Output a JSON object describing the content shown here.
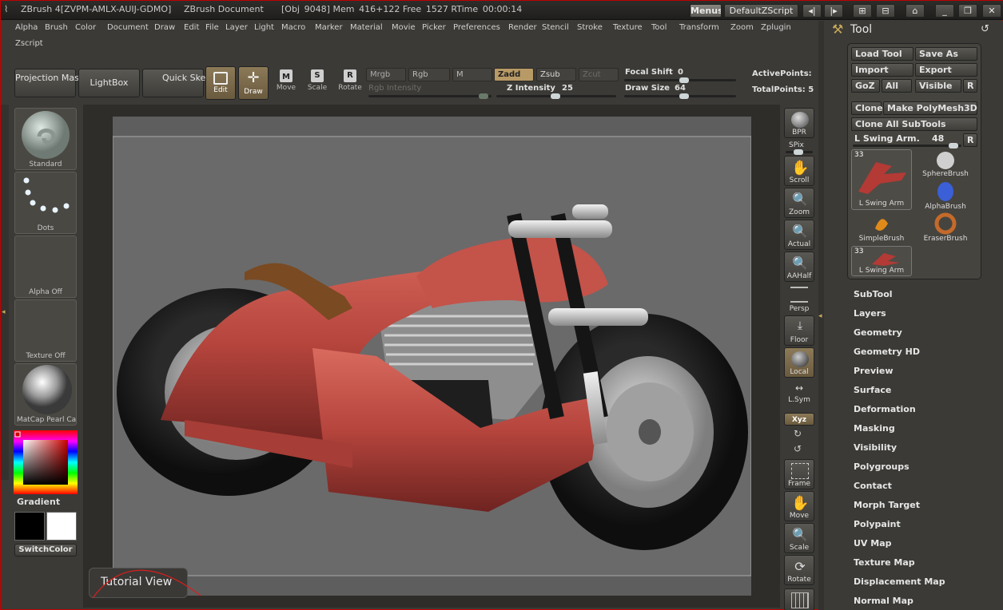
{
  "titlebar": {
    "app": "ZBrush 4[ZVPM-AMLX-AUIJ-GDMO]",
    "doc": "ZBrush Document",
    "stats": "[Obj  9048] Mem  416+122  Free  1527  RTime  00:00:14",
    "menus_btn": "Menus",
    "script_btn": "DefaultZScript"
  },
  "menu": [
    "Alpha",
    "Brush",
    "Color",
    "Document",
    "Draw",
    "Edit",
    "File",
    "Layer",
    "Light",
    "Macro",
    "Marker",
    "Material",
    "Movie",
    "Picker",
    "Preferences",
    "Render",
    "Stencil",
    "Stroke",
    "Texture",
    "Tool",
    "Transform",
    "Zoom",
    "Zplugin",
    "Zscript"
  ],
  "topshelf": {
    "projection_master": "Projection Master",
    "lightbox": "LightBox",
    "quick_sketch": "Quick Sketch",
    "edit": "Edit",
    "draw": "Draw",
    "move": "Move",
    "scale": "Scale",
    "rotate": "Rotate",
    "mrgb": "Mrgb",
    "rgb": "Rgb",
    "m": "M",
    "zadd": "Zadd",
    "zsub": "Zsub",
    "zcut": "Zcut",
    "rgb_intensity": "Rgb Intensity",
    "z_intensity_label": "Z Intensity",
    "z_intensity_value": "25",
    "focal_shift_label": "Focal Shift",
    "focal_shift_value": "0",
    "draw_size_label": "Draw Size",
    "draw_size_value": "64",
    "active_points": "ActivePoints:",
    "total_points": "TotalPoints: 5"
  },
  "leftshelf": {
    "brush": "Standard",
    "stroke": "Dots",
    "alpha": "Alpha Off",
    "texture": "Texture Off",
    "material": "MatCap Pearl Ca",
    "gradient": "Gradient",
    "switch_color": "SwitchColor"
  },
  "rightshelf": [
    "BPR",
    "SPix",
    "Scroll",
    "Zoom",
    "Actual",
    "AAHalf",
    "Persp",
    "Floor",
    "Local",
    "L.Sym",
    "Xyz",
    "Frame",
    "Move",
    "Scale",
    "Rotate"
  ],
  "canvas": {
    "tutorial_view": "Tutorial View"
  },
  "tool": {
    "title": "Tool",
    "load_tool": "Load Tool",
    "save_as": "Save As",
    "import": "Import",
    "export": "Export",
    "goz": "GoZ",
    "all": "All",
    "visible": "Visible",
    "r": "R",
    "clone": "Clone",
    "make_polymesh": "Make PolyMesh3D",
    "clone_all": "Clone All SubTools",
    "current_tool_label": "L Swing Arm.",
    "current_tool_value": "48",
    "thumbs": [
      {
        "name": "L Swing Arm",
        "count": "33"
      },
      {
        "name": "SphereBrush"
      },
      {
        "name": "AlphaBrush"
      },
      {
        "name": "SimpleBrush"
      },
      {
        "name": "EraserBrush"
      },
      {
        "name": "L Swing Arm",
        "count": "33"
      }
    ],
    "subpalettes": [
      "SubTool",
      "Layers",
      "Geometry",
      "Geometry HD",
      "Preview",
      "Surface",
      "Deformation",
      "Masking",
      "Visibility",
      "Polygroups",
      "Contact",
      "Morph Target",
      "Polypaint",
      "UV Map",
      "Texture Map",
      "Displacement Map",
      "Normal Map"
    ]
  },
  "colors": {
    "accent_red": "#c00000",
    "model_red": "#b5453d",
    "seat_brown": "#7a4a22"
  }
}
